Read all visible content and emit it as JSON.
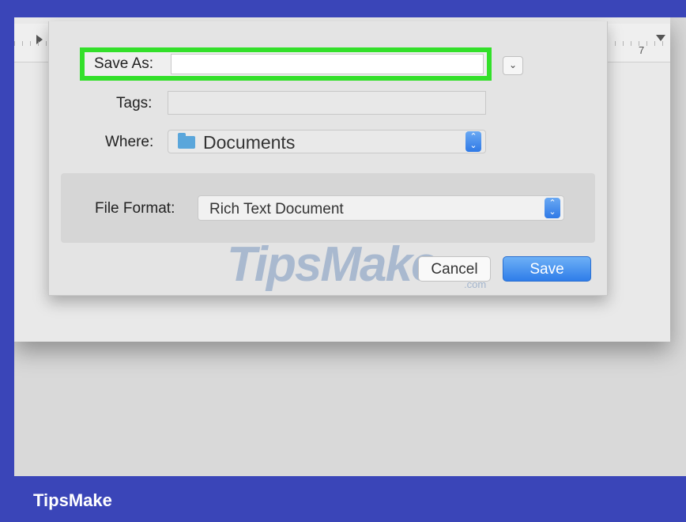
{
  "ruler": {
    "number_label": "7"
  },
  "dialog": {
    "save_as_label": "Save As:",
    "save_as_value": "",
    "tags_label": "Tags:",
    "tags_value": "",
    "where_label": "Where:",
    "where_value": "Documents",
    "file_format_label": "File Format:",
    "file_format_value": "Rich Text Document",
    "cancel_label": "Cancel",
    "save_label": "Save",
    "expand_glyph": "⌄",
    "stepper_glyph": "⌃⌄"
  },
  "watermark": {
    "text": "TipsMake",
    "suffix": ".com"
  },
  "brand": {
    "text": "TipsMake"
  },
  "colors": {
    "highlight": "#33e02a",
    "accent": "#2f7de9",
    "frame": "#3a45b8"
  },
  "icons": [
    "folder-icon",
    "chevron-down-icon",
    "stepper-icon"
  ]
}
